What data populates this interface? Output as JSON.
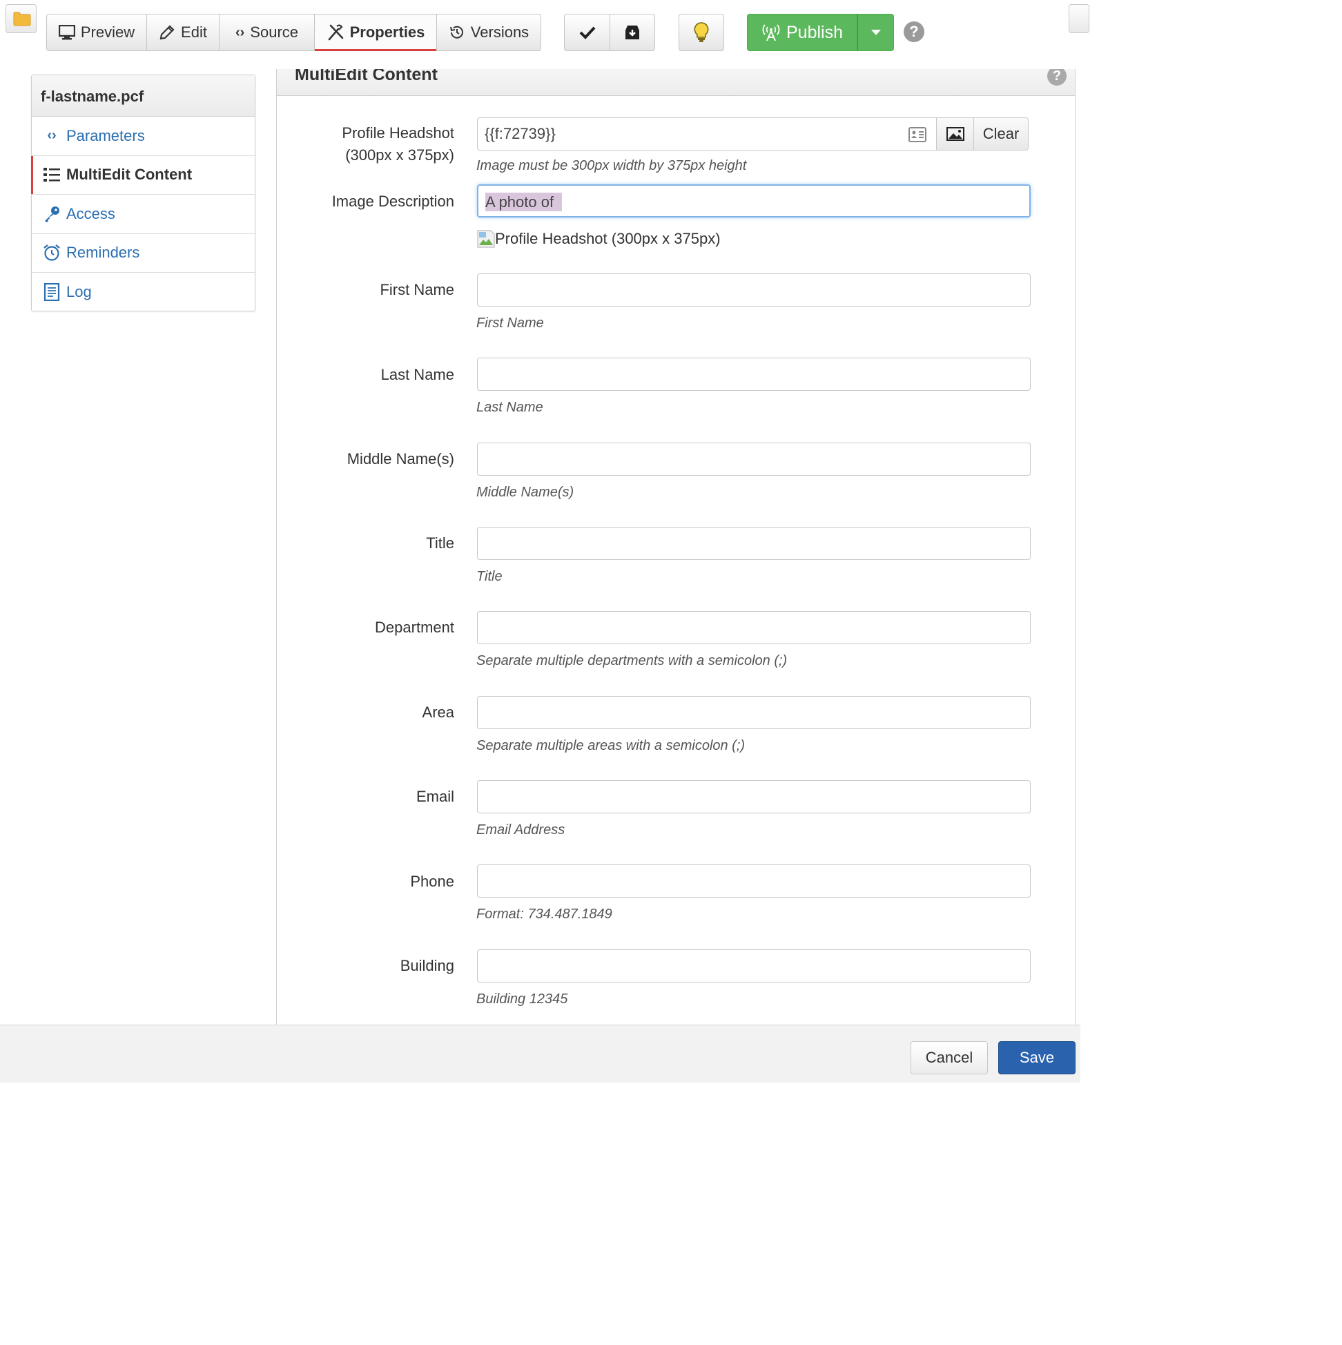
{
  "toolbar": {
    "buttons": [
      {
        "label": "Preview",
        "icon": "monitor-icon"
      },
      {
        "label": "Edit",
        "icon": "pencil-icon"
      },
      {
        "label": "Source",
        "icon": "code-icon"
      },
      {
        "label": "Properties",
        "icon": "tools-icon",
        "active": true
      },
      {
        "label": "Versions",
        "icon": "history-icon"
      }
    ],
    "publish_label": "Publish",
    "help_glyph": "?"
  },
  "sidebar": {
    "file_name": "f-lastname.pcf",
    "items": [
      {
        "label": "Parameters",
        "icon": "code-icon"
      },
      {
        "label": "MultiEdit Content",
        "icon": "list-icon",
        "active": true
      },
      {
        "label": "Access",
        "icon": "key-icon"
      },
      {
        "label": "Reminders",
        "icon": "alarm-clock-icon"
      },
      {
        "label": "Log",
        "icon": "document-icon"
      }
    ]
  },
  "panel": {
    "title": "MultiEdit Content",
    "help_glyph": "?"
  },
  "form": {
    "headshot": {
      "label_line1": "Profile Headshot",
      "label_line2": "(300px x 375px)",
      "value": "{{f:72739}}",
      "clear_label": "Clear",
      "help": "Image must be 300px width by 375px height"
    },
    "image_description": {
      "label": "Image Description",
      "value": "A photo of "
    },
    "image_alt": "Profile Headshot (300px x 375px)",
    "fields": [
      {
        "label": "First Name",
        "help": "First Name",
        "value": ""
      },
      {
        "label": "Last Name",
        "help": "Last Name",
        "value": ""
      },
      {
        "label": "Middle Name(s)",
        "help": "Middle Name(s)",
        "value": ""
      },
      {
        "label": "Title",
        "help": "Title",
        "value": ""
      },
      {
        "label": "Department",
        "help": "Separate multiple departments with a semicolon (;)",
        "value": ""
      },
      {
        "label": "Area",
        "help": "Separate multiple areas with a semicolon (;)",
        "value": ""
      },
      {
        "label": "Email",
        "help": "Email Address",
        "value": ""
      },
      {
        "label": "Phone",
        "help": "Format: 734.487.1849",
        "value": ""
      },
      {
        "label": "Building",
        "help": "Building 12345",
        "value": ""
      }
    ]
  },
  "footer": {
    "cancel_label": "Cancel",
    "save_label": "Save"
  },
  "colors": {
    "publish_green": "#5cb85c",
    "save_blue": "#2a62ae",
    "link_blue": "#2a6eb0",
    "active_red": "#d9403a"
  }
}
